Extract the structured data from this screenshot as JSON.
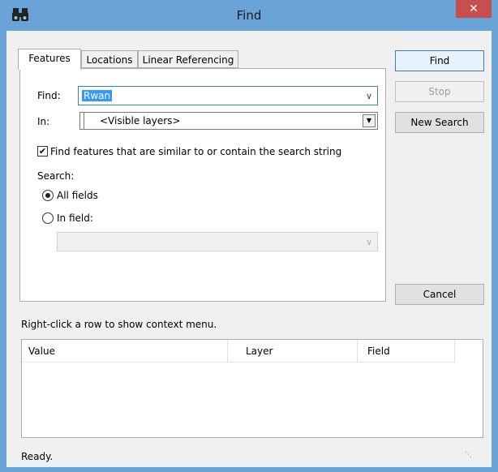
{
  "window": {
    "title": "Find",
    "close_glyph": "✕",
    "accent": "#6aa3d8",
    "close_color": "#c74f4f"
  },
  "tabs": [
    {
      "label": "Features",
      "active": true
    },
    {
      "label": "Locations",
      "active": false
    },
    {
      "label": "Linear Referencing",
      "active": false
    }
  ],
  "features": {
    "find_label": "Find:",
    "find_value": "Rwan",
    "in_label": "In:",
    "in_value": "<Visible layers>",
    "similar_checkbox_label": "Find features that are similar to or contain the search string",
    "similar_checked": true,
    "search_label": "Search:",
    "all_fields_label": "All fields",
    "all_fields_selected": true,
    "in_field_label": "In field:",
    "in_field_selected": false,
    "in_field_value": ""
  },
  "buttons": {
    "find": "Find",
    "stop": "Stop",
    "new_search": "New Search",
    "cancel": "Cancel"
  },
  "results": {
    "hint": "Right-click a row to show context menu.",
    "columns": [
      "Value",
      "Layer",
      "Field"
    ],
    "rows": []
  },
  "status": {
    "text": "Ready."
  },
  "icons": {
    "app": "binoculars-icon",
    "close": "close-icon",
    "chevron": "chevron-down-icon",
    "dropdown": "dropdown-arrow-icon",
    "grip": "resize-grip-icon"
  }
}
